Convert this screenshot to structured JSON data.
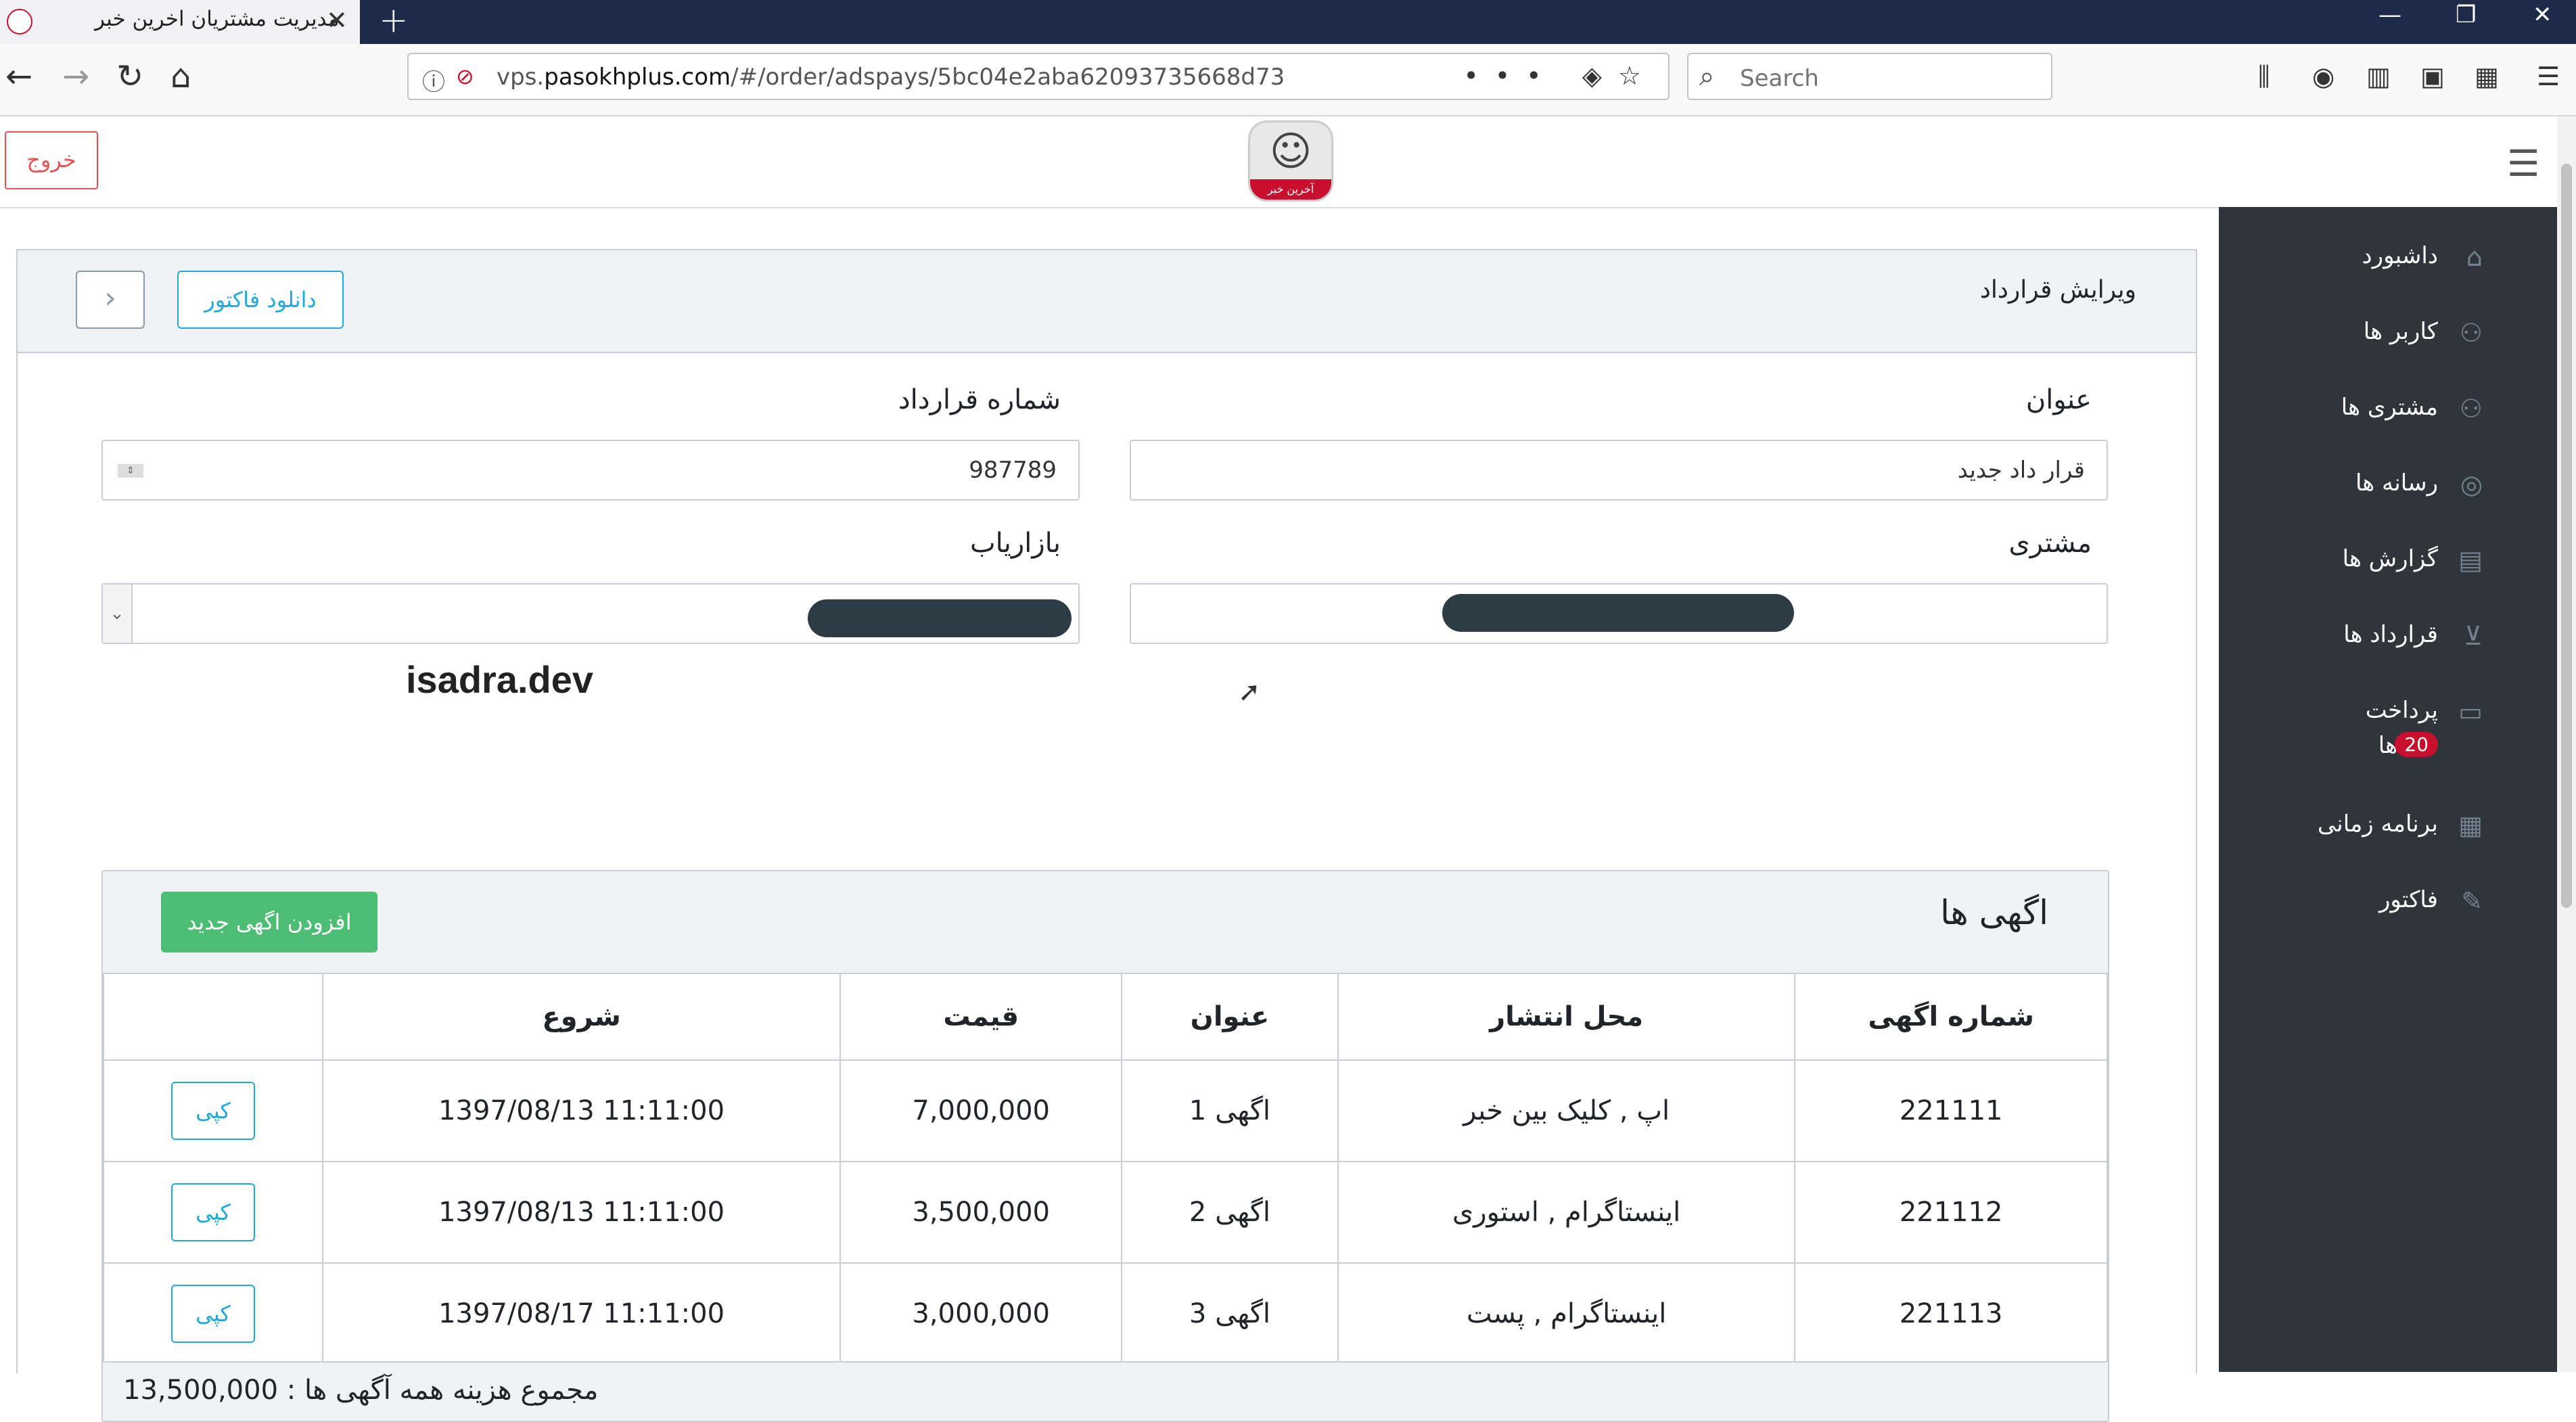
{
  "browser": {
    "tab_title": "مدیریت مشتریان اخرین خبر",
    "tab_close": "✕",
    "new_tab": "+",
    "url_prefix": "vps.",
    "url_domain": "pasokhplus.com",
    "url_path": "/#/order/adspays/5bc04e2aba62093735668d73",
    "search_placeholder": "Search",
    "url_more": "•••"
  },
  "header": {
    "logout_label": "خروج",
    "logo_text": "آخرین خبر"
  },
  "sidebar": {
    "items": [
      {
        "label": "داشبورد",
        "icon": "home-icon"
      },
      {
        "label": "کاربر ها",
        "icon": "user-icon"
      },
      {
        "label": "مشتری ها",
        "icon": "users-icon"
      },
      {
        "label": "رسانه ها",
        "icon": "instagram-icon"
      },
      {
        "label": "گزارش ها",
        "icon": "book-icon"
      },
      {
        "label": "قرارداد ها",
        "icon": "cart-icon"
      },
      {
        "label": "پرداخت",
        "label_2": "ها",
        "badge": "20",
        "icon": "credit-card-icon"
      },
      {
        "label": "برنامه زمانی",
        "icon": "calendar-icon"
      },
      {
        "label": "فاکتور",
        "icon": "edit-icon"
      }
    ]
  },
  "card": {
    "title": "ویرایش قرارداد",
    "download_invoice_label": "دانلود فاکتور",
    "back_label": "‹"
  },
  "form": {
    "title_label": "عنوان",
    "title_value": "قرار داد جدید",
    "contract_number_label": "شماره قرارداد",
    "contract_number_value": "987789",
    "customer_label": "مشتری",
    "marketer_label": "بازاریاب"
  },
  "watermark": "isadra.dev",
  "ads": {
    "title": "اگهی ها",
    "add_button_label": "افزودن اگهی جدید",
    "columns": [
      "شماره اگهی",
      "محل انتشار",
      "عنوان",
      "قیمت",
      "شروع",
      ""
    ],
    "rows": [
      {
        "number": "221111",
        "place": "اپ , کلیک بین خبر",
        "title": "اگهی 1",
        "price": "7,000,000",
        "start": "1397/08/13 11:11:00",
        "action": "کپی"
      },
      {
        "number": "221112",
        "place": "اینستاگرام , استوری",
        "title": "اگهی 2",
        "price": "3,500,000",
        "start": "1397/08/13 11:11:00",
        "action": "کپی"
      },
      {
        "number": "221113",
        "place": "اینستاگرام , پست",
        "title": "اگهی 3",
        "price": "3,000,000",
        "start": "1397/08/17 11:11:00",
        "action": "کپی"
      }
    ],
    "total_text": "مجموع هزینه همه آگهی ها : 13,500,000"
  }
}
